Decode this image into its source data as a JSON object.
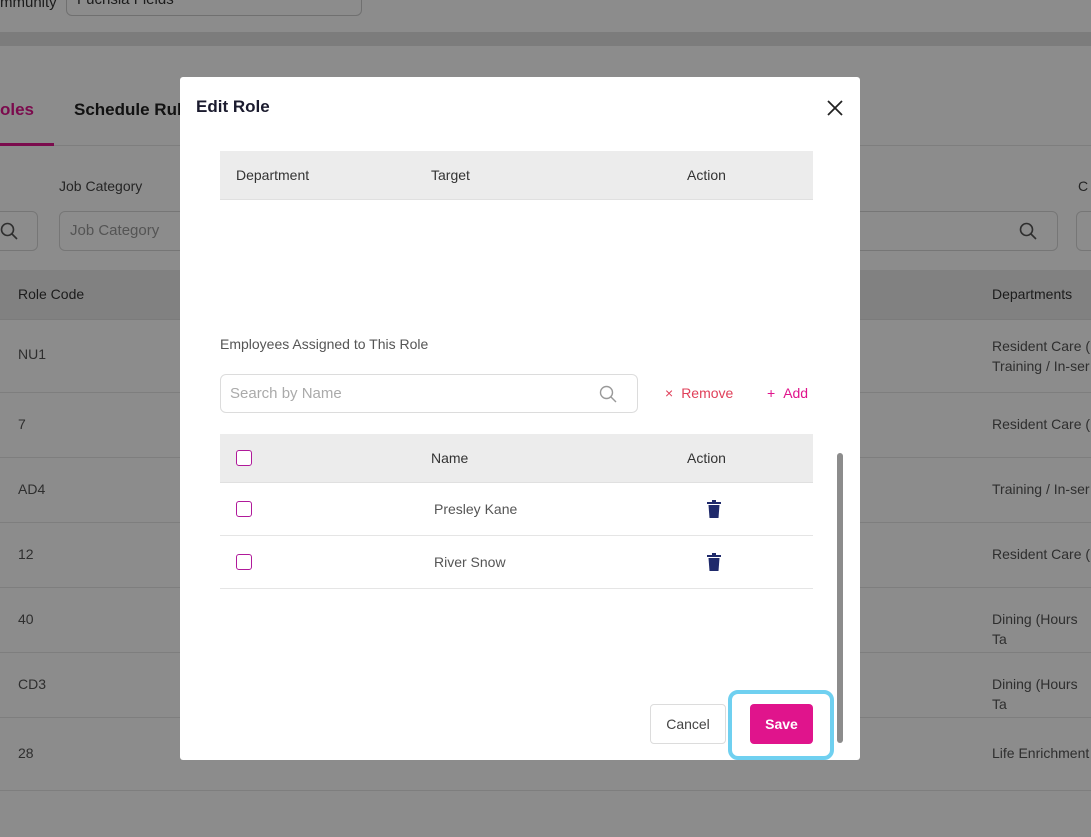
{
  "background": {
    "community_label": "mmunity",
    "community_value": "Fuchsia Fields",
    "tabs": [
      {
        "label": "oles",
        "active": true
      },
      {
        "label": "Schedule Rul",
        "active": false
      }
    ],
    "filters": {
      "job_category_label": "Job Category",
      "job_category_placeholder": "Job Category",
      "right_label": "C"
    },
    "table": {
      "headers": [
        "Role Code",
        "Departments"
      ],
      "rows": [
        {
          "code": "NU1",
          "departments": "Resident Care (\nTraining / In-ser"
        },
        {
          "code": "7",
          "departments": "Resident Care ("
        },
        {
          "code": "AD4",
          "departments": "Training / In-ser"
        },
        {
          "code": "12",
          "departments": "Resident Care ("
        },
        {
          "code": "40",
          "departments": "Dining (Hours Ta"
        },
        {
          "code": "CD3",
          "departments": "Dining (Hours Ta"
        },
        {
          "code": "28",
          "departments": "Life Enrichment"
        }
      ]
    }
  },
  "modal": {
    "title": "Edit Role",
    "dept_table": {
      "headers": [
        "Department",
        "Target",
        "Action"
      ]
    },
    "employees_label": "Employees Assigned to This Role",
    "search_placeholder": "Search by Name",
    "remove_label": "Remove",
    "add_label": "Add",
    "emp_table": {
      "headers": [
        "Name",
        "Action"
      ],
      "rows": [
        {
          "name": "Presley Kane"
        },
        {
          "name": "River Snow"
        }
      ]
    },
    "cancel_label": "Cancel",
    "save_label": "Save"
  },
  "colors": {
    "accent": "#e0148c",
    "remove": "#e0405a",
    "trash": "#1f2a6b",
    "highlight": "#6fd0f0"
  },
  "icons": [
    "close-icon",
    "search-icon",
    "trash-icon",
    "checkbox"
  ]
}
